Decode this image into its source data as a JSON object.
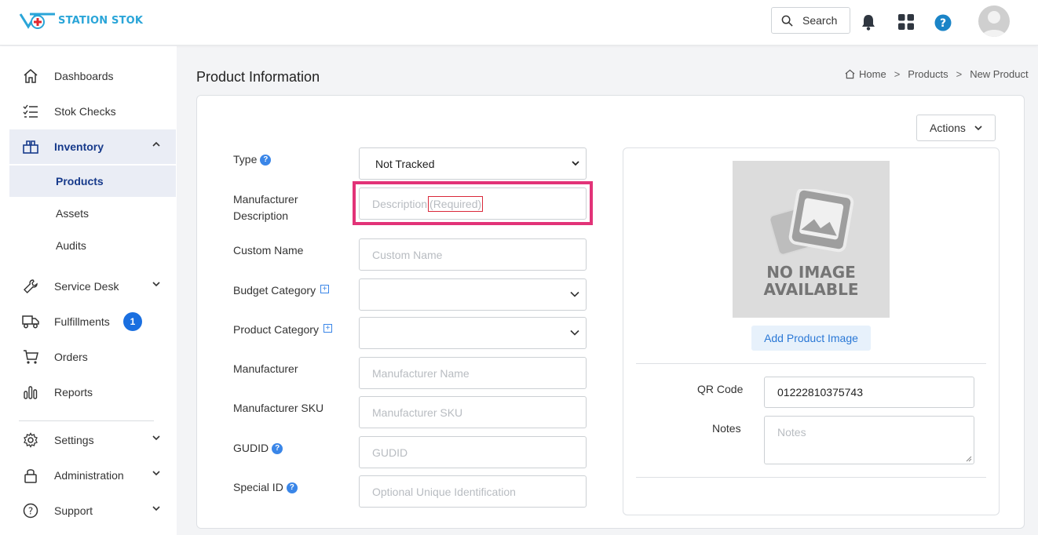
{
  "app": {
    "logo_text": "STATION STOK"
  },
  "topbar": {
    "search_label": "Search"
  },
  "sidebar": {
    "items": [
      {
        "label": "Dashboards"
      },
      {
        "label": "Stok Checks"
      },
      {
        "label": "Inventory"
      },
      {
        "label": "Products"
      },
      {
        "label": "Assets"
      },
      {
        "label": "Audits"
      },
      {
        "label": "Service Desk"
      },
      {
        "label": "Fulfillments",
        "badge": "1"
      },
      {
        "label": "Orders"
      },
      {
        "label": "Reports"
      },
      {
        "label": "Settings"
      },
      {
        "label": "Administration"
      },
      {
        "label": "Support"
      }
    ]
  },
  "main": {
    "title": "Product Information",
    "breadcrumb": [
      "Home",
      "Products",
      "New Product"
    ],
    "actions_label": "Actions"
  },
  "form": {
    "type": {
      "label": "Type",
      "value": "Not Tracked"
    },
    "manufacturer_description": {
      "label_line1": "Manufacturer",
      "label_line2": "Description",
      "placeholder": "Description",
      "required": "(Required)"
    },
    "custom_name": {
      "label": "Custom Name",
      "placeholder": "Custom Name"
    },
    "budget_category": {
      "label": "Budget Category",
      "value": ""
    },
    "product_category": {
      "label": "Product Category",
      "value": ""
    },
    "manufacturer": {
      "label": "Manufacturer",
      "placeholder": "Manufacturer Name"
    },
    "manufacturer_sku": {
      "label": "Manufacturer SKU",
      "placeholder": "Manufacturer SKU"
    },
    "gudid": {
      "label": "GUDID",
      "placeholder": "GUDID"
    },
    "special_id": {
      "label": "Special ID",
      "placeholder": "Optional Unique Identification"
    }
  },
  "image_panel": {
    "no_image_line1": "NO IMAGE",
    "no_image_line2": "AVAILABLE",
    "add_image_label": "Add Product Image",
    "qr_code": {
      "label": "QR Code",
      "value": "01222810375743"
    },
    "notes": {
      "label": "Notes",
      "placeholder": "Notes"
    }
  },
  "colors": {
    "accent": "#173a8b",
    "highlight": "#e23378",
    "link": "#2a78d6",
    "badge": "#1a6fe0"
  }
}
